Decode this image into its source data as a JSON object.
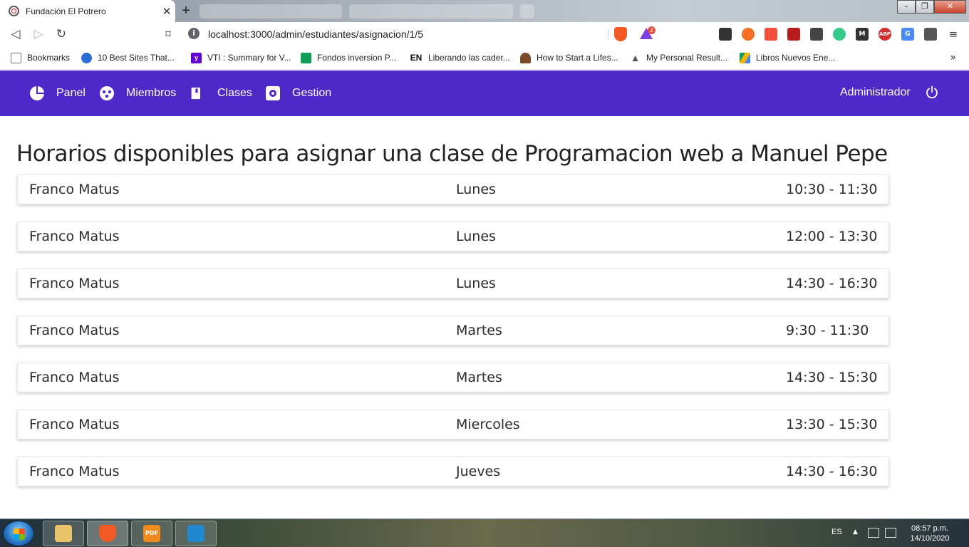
{
  "browser": {
    "tab_title": "Fundación El Potrero",
    "tab_close": "✕",
    "new_tab": "+",
    "url": "localhost:3000/admin/estudiantes/asignacion/1/5",
    "badge_count": "2",
    "bookmarks": [
      {
        "label": "Bookmarks",
        "icon": "bookmarks-icon",
        "color": "#777777"
      },
      {
        "label": "10 Best Sites That...",
        "icon": "site-icon",
        "color": "#2b6cd4"
      },
      {
        "label": "VTI : Summary for V...",
        "icon": "yahoo-icon",
        "color": "#6001d2"
      },
      {
        "label": "Fondos inversion P...",
        "icon": "sheets-icon",
        "color": "#0f9d58"
      },
      {
        "label": "Liberando las cader...",
        "icon": "en-icon",
        "color": "#111111"
      },
      {
        "label": "How to Start a Lifes...",
        "icon": "person-icon",
        "color": "#7a4a2a"
      },
      {
        "label": "My Personal Result...",
        "icon": "triangle-icon",
        "color": "#555555"
      },
      {
        "label": "Libros Nuevos Ene...",
        "icon": "drive-icon",
        "color": "#f4b400"
      }
    ],
    "bookmarks_more": "»"
  },
  "nav": {
    "items": [
      {
        "label": "Panel",
        "icon": "pie-chart-icon"
      },
      {
        "label": "Miembros",
        "icon": "users-icon"
      },
      {
        "label": "Clases",
        "icon": "book-icon"
      },
      {
        "label": "Gestion",
        "icon": "settings-icon"
      }
    ],
    "user": "Administrador",
    "color": "#4f29c7"
  },
  "page": {
    "title": "Horarios disponibles para asignar una clase de Programacion web a Manuel Pepe"
  },
  "slots": [
    {
      "teacher": "Franco Matus",
      "day": "Lunes",
      "time": "10:30 - 11:30"
    },
    {
      "teacher": "Franco Matus",
      "day": "Lunes",
      "time": "12:00 - 13:30"
    },
    {
      "teacher": "Franco Matus",
      "day": "Lunes",
      "time": "14:30 - 16:30"
    },
    {
      "teacher": "Franco Matus",
      "day": "Martes",
      "time": "9:30 - 11:30"
    },
    {
      "teacher": "Franco Matus",
      "day": "Martes",
      "time": "14:30 - 15:30"
    },
    {
      "teacher": "Franco Matus",
      "day": "Miercoles",
      "time": "13:30 - 15:30"
    },
    {
      "teacher": "Franco Matus",
      "day": "Jueves",
      "time": "14:30 - 16:30"
    }
  ],
  "taskbar": {
    "language": "ES",
    "time": "08:57 p.m.",
    "date": "14/10/2020"
  }
}
